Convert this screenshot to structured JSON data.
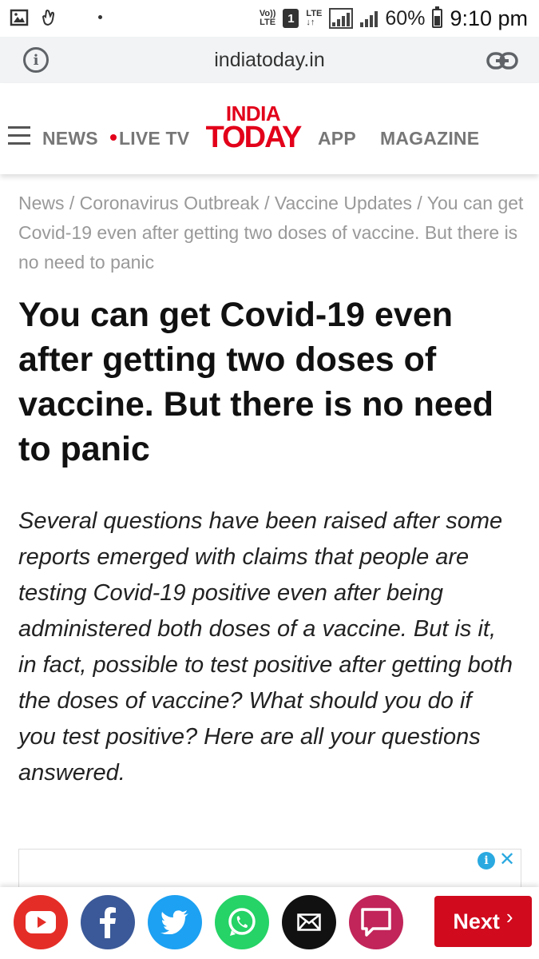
{
  "status_bar": {
    "volte_label": "Vo)) LTE",
    "sim_number": "1",
    "network": "LTE",
    "battery_percent": "60%",
    "battery_level": 0.6,
    "time": "9:10 pm"
  },
  "browser": {
    "url": "indiatoday.in",
    "info_icon": "info-icon",
    "link_icon": "link-icon"
  },
  "header": {
    "nav_news": "NEWS",
    "nav_live_tv": "LIVE TV",
    "logo_line1": "INDIA",
    "logo_line2": "TODAY",
    "nav_app": "APP",
    "nav_magazine": "MAGAZINE",
    "brand_color": "#e2001a"
  },
  "breadcrumb": "News / Coronavirus Outbreak / Vaccine Updates / You can get Covid-19 even after getting two doses of vaccine. But there is no need to panic",
  "article": {
    "headline": "You can get Covid-19 even after getting two doses of vaccine. But there is no need to panic",
    "summary": "Several questions have been raised after some reports emerged with claims that people are testing Covid-19 positive even after being administered both doses of a vaccine. But is it, in fact, possible to test positive after getting both the doses of vaccine? What should you do if you test positive? Here are all your questions answered."
  },
  "ad": {
    "info_glyph": "i",
    "close_glyph": "✕"
  },
  "share_bar": {
    "buttons": [
      "youtube-icon",
      "facebook-icon",
      "twitter-icon",
      "whatsapp-icon",
      "mail-icon",
      "comment-icon"
    ],
    "next_label": "Next",
    "next_chevron": "›",
    "next_color": "#d10a1e"
  }
}
